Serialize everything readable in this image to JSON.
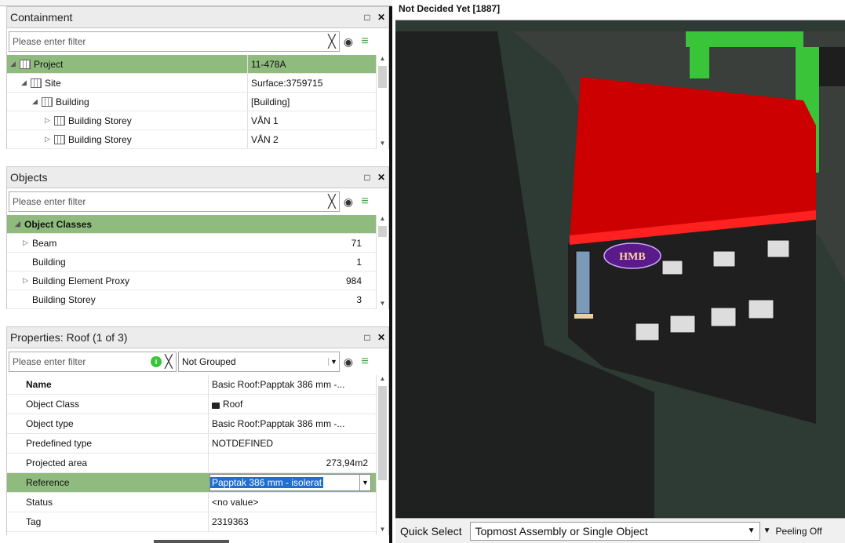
{
  "containment": {
    "title": "Containment",
    "filter_placeholder": "Please enter filter",
    "rows": [
      {
        "name": "Project",
        "value": "11-478A",
        "indent": 0,
        "expanded": true
      },
      {
        "name": "Site",
        "value": "Surface:3759715",
        "indent": 1,
        "expanded": true
      },
      {
        "name": "Building",
        "value": "[Building]",
        "indent": 2,
        "expanded": true
      },
      {
        "name": "Building Storey",
        "value": "VÅN 1",
        "indent": 3,
        "expanded": false
      },
      {
        "name": "Building Storey",
        "value": "VÅN 2",
        "indent": 3,
        "expanded": false
      }
    ]
  },
  "objects": {
    "title": "Objects",
    "filter_placeholder": "Please enter filter",
    "header": "Object Classes",
    "rows": [
      {
        "name": "Beam",
        "count": "71",
        "expandable": true
      },
      {
        "name": "Building",
        "count": "1",
        "expandable": false
      },
      {
        "name": "Building Element Proxy",
        "count": "984",
        "expandable": true
      },
      {
        "name": "Building Storey",
        "count": "3",
        "expandable": false
      }
    ]
  },
  "properties": {
    "title": "Properties: Roof (1 of 3)",
    "filter_placeholder": "Please enter filter",
    "grouping": "Not Grouped",
    "rows": [
      {
        "name": "Name",
        "value": "Basic Roof:Papptak 386 mm -...",
        "bold": true
      },
      {
        "name": "Object Class",
        "value": "Roof",
        "lock": true
      },
      {
        "name": "Object type",
        "value": "Basic Roof:Papptak 386 mm -..."
      },
      {
        "name": "Predefined type",
        "value": "NOTDEFINED"
      },
      {
        "name": "Projected area",
        "value": "273,94m2",
        "align": "right"
      },
      {
        "name": "Reference",
        "value": "Papptak 386 mm - isolerat",
        "editing": true
      },
      {
        "name": "Status",
        "value": "<no value>"
      },
      {
        "name": "Tag",
        "value": "2319363"
      }
    ]
  },
  "viewport": {
    "title": "Not Decided Yet [1887]",
    "sign_text": "HMB"
  },
  "quick_select": {
    "label": "Quick Select",
    "value": "Topmost Assembly or Single Object",
    "peeling": "Peeling Off"
  },
  "icons": {
    "maximize": "□",
    "close": "✕",
    "clear": "╳",
    "gear": "◉",
    "menu": "≡",
    "info": "i"
  },
  "colors": {
    "selected_row": "#8fbc7e",
    "roof": "#cc0000",
    "accent_green": "#3ac43a",
    "sign_purple": "#5a1a8a"
  }
}
